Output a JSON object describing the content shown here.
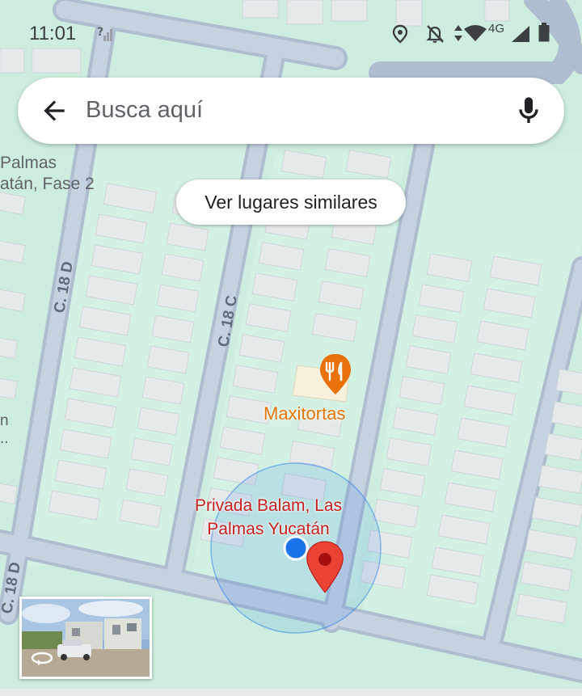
{
  "status_bar": {
    "time": "11:01",
    "network": "4G",
    "icons": [
      "unknown-signal-icon",
      "location-icon",
      "notifications-off-icon",
      "data-arrows-icon",
      "wifi-icon",
      "cell-signal-icon",
      "battery-icon"
    ]
  },
  "search": {
    "placeholder": "Busca aquí",
    "back_icon": "arrow-back-icon",
    "mic_icon": "microphone-icon"
  },
  "similar_places_chip": "Ver lugares similares",
  "map": {
    "street_labels": [
      "C. 18 D",
      "C. 18 C",
      "C. 18 D"
    ],
    "area_label_line1": "Palmas",
    "area_label_line2": "atán, Fase 2",
    "edge_label_line1": "n",
    "edge_label_line2": "..",
    "poi": {
      "name": "Maxitortas",
      "icon": "restaurant-icon",
      "color": "#e37400"
    },
    "pin_label_line1": "Privada Balam, Las",
    "pin_label_line2": "Palmas Yucatán",
    "pin_color": "#c5221f",
    "my_location_color": "#1a73e8"
  },
  "colors": {
    "map_bg": "#cdeede",
    "road": "#aebdd0",
    "block": "#e8eaea",
    "poi_text": "#e37400",
    "pin_text": "#c5221f"
  },
  "street_view_thumbnail": {
    "icon": "rotate-360-icon"
  }
}
